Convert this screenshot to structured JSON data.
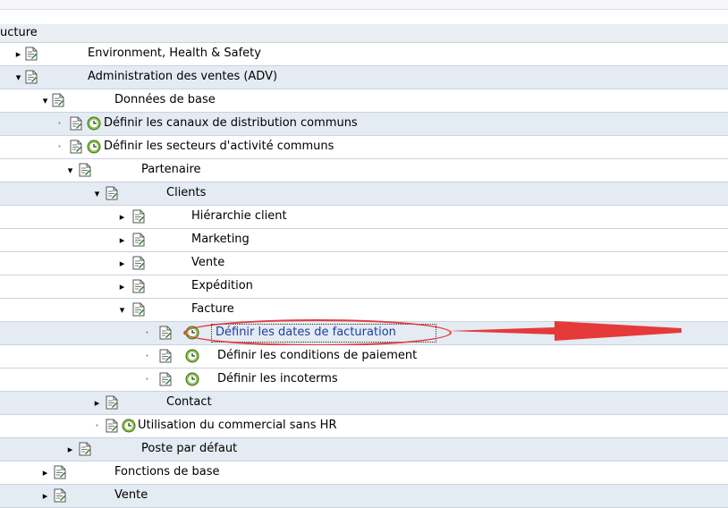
{
  "header": {
    "title": "ucture"
  },
  "tree": [
    {
      "id": "ehs",
      "label": "Environment, Health & Safety",
      "state": "closed",
      "icon": "document-icon",
      "bg": "white"
    },
    {
      "id": "adv",
      "label": "Administration des ventes (ADV)",
      "state": "open",
      "icon": "document-icon",
      "bg": "blue"
    },
    {
      "id": "donnees",
      "label": "Données de base",
      "state": "open",
      "icon": "document-icon",
      "bg": "white"
    },
    {
      "id": "canaux",
      "label": "Définir les canaux de distribution communs",
      "state": "leaf",
      "icon": "document-icon",
      "clock": true,
      "bg": "blue"
    },
    {
      "id": "secteurs",
      "label": "Définir les secteurs d'activité communs",
      "state": "leaf",
      "icon": "document-icon",
      "clock": true,
      "bg": "white"
    },
    {
      "id": "partenaire",
      "label": "Partenaire",
      "state": "open",
      "icon": "document-icon",
      "bg": "white"
    },
    {
      "id": "clients",
      "label": "Clients",
      "state": "open",
      "icon": "document-icon",
      "bg": "blue"
    },
    {
      "id": "hierarchie",
      "label": "Hiérarchie client",
      "state": "closed",
      "icon": "document-icon",
      "bg": "white"
    },
    {
      "id": "marketing",
      "label": "Marketing",
      "state": "closed",
      "icon": "document-icon",
      "bg": "white"
    },
    {
      "id": "vente-c",
      "label": "Vente",
      "state": "closed",
      "icon": "document-icon",
      "bg": "white"
    },
    {
      "id": "expedition",
      "label": "Expédition",
      "state": "closed",
      "icon": "document-icon",
      "bg": "white"
    },
    {
      "id": "facture",
      "label": "Facture",
      "state": "open",
      "icon": "document-icon",
      "bg": "white"
    },
    {
      "id": "dates",
      "label": "Définir les dates de facturation",
      "state": "leaf",
      "icon": "document-icon",
      "clock": true,
      "bg": "blue",
      "selected": true
    },
    {
      "id": "conditions",
      "label": "Définir les conditions de paiement",
      "state": "leaf",
      "icon": "document-icon",
      "clock": true,
      "bg": "white"
    },
    {
      "id": "incoterms",
      "label": "Définir les incoterms",
      "state": "leaf",
      "icon": "document-icon",
      "clock": true,
      "bg": "white"
    },
    {
      "id": "contact",
      "label": "Contact",
      "state": "closed",
      "icon": "document-icon",
      "bg": "blue"
    },
    {
      "id": "utilisation",
      "label": "Utilisation du commercial sans HR",
      "state": "leaf",
      "icon": "document-icon",
      "clock": true,
      "bg": "white"
    },
    {
      "id": "poste",
      "label": "Poste par défaut",
      "state": "closed",
      "icon": "document-icon",
      "bg": "blue"
    },
    {
      "id": "fonctions",
      "label": "Fonctions de base",
      "state": "closed",
      "icon": "document-icon",
      "bg": "white"
    },
    {
      "id": "vente",
      "label": "Vente",
      "state": "closed",
      "icon": "document-icon",
      "bg": "blue"
    }
  ],
  "colors": {
    "highlight": "#e53a3a",
    "link": "#1d3f9e",
    "row_alt": "#e4ebf3"
  }
}
